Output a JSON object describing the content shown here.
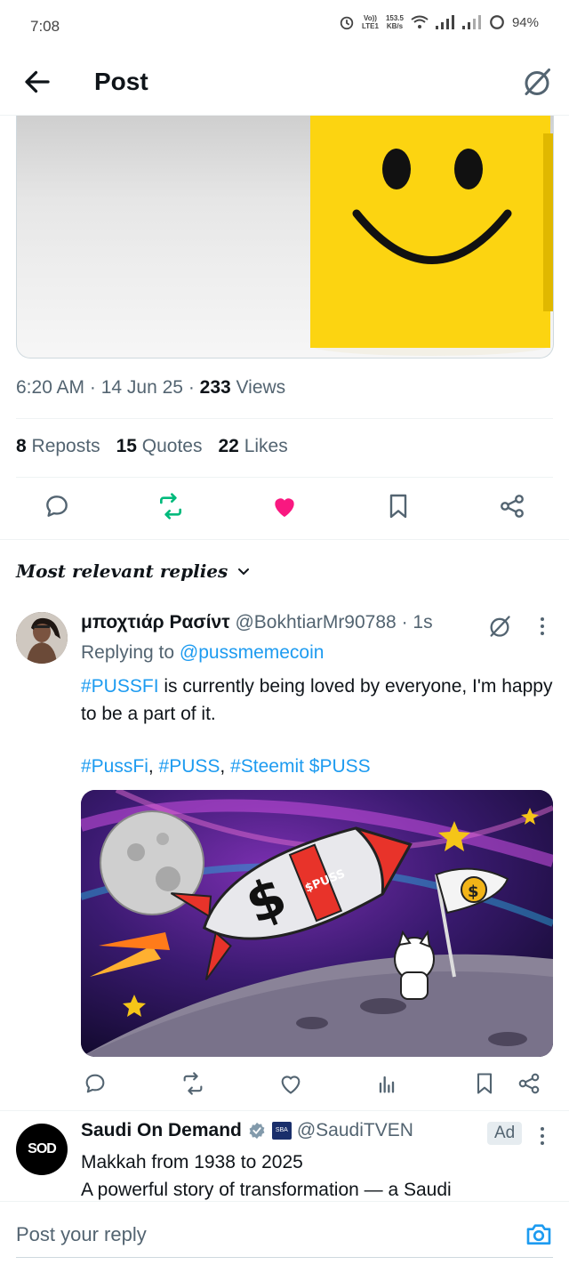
{
  "status": {
    "time": "7:08",
    "net_top": "153.5",
    "net_bottom": "KB/s",
    "volte_top": "Vo))",
    "volte_bottom": "LTE1",
    "battery": "94%"
  },
  "header": {
    "title": "Post"
  },
  "post": {
    "time": "6:20 AM",
    "date": "14 Jun 25",
    "views_count": "233",
    "views_label": "Views",
    "reposts_count": "8",
    "reposts_label": "Reposts",
    "quotes_count": "15",
    "quotes_label": "Quotes",
    "likes_count": "22",
    "likes_label": "Likes",
    "liked": true,
    "reposted": true
  },
  "replies_filter": {
    "label": "Most relevant replies"
  },
  "reply": {
    "name": "μποχτιάρ Ρασίντ",
    "handle": "@BokhtiarMr90788",
    "time": "1s",
    "replying_prefix": "Replying to",
    "replying_to": "@pussmemecoin",
    "text_tag": "#PUSSFI",
    "text_rest": " is currently being loved by everyone, I'm happy to be a part of it.",
    "tags": [
      "#PussFi",
      "#PUSS",
      "#Steemit",
      "$PUSS"
    ],
    "image_alt_text": "$PUSS"
  },
  "ad": {
    "name": "Saudi On Demand",
    "handle": "@SaudiTVEN",
    "flag_text": "SBA",
    "avatar_text": "SOD",
    "badge": "Ad",
    "line1": "Makkah from 1938 to 2025",
    "line2": "A powerful story of transformation — a Saudi"
  },
  "compose": {
    "placeholder": "Post your reply"
  },
  "colors": {
    "accent": "#1d9bf0",
    "like": "#f91880",
    "repost": "#00ba7c",
    "text_secondary": "#536471"
  },
  "icons": [
    "back-arrow-icon",
    "grok-icon",
    "comment-icon",
    "repost-icon",
    "heart-icon",
    "bookmark-icon",
    "share-icon",
    "chevron-down-icon",
    "more-vertical-icon",
    "analytics-icon",
    "verified-badge-icon",
    "camera-icon"
  ]
}
